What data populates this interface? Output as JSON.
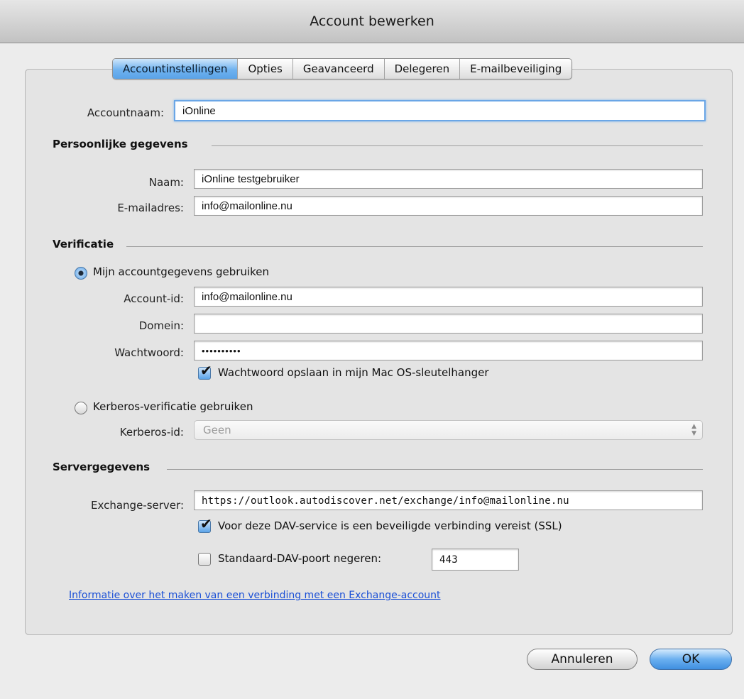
{
  "window": {
    "title": "Account bewerken"
  },
  "tabs": [
    {
      "label": "Accountinstellingen",
      "active": true
    },
    {
      "label": "Opties"
    },
    {
      "label": "Geavanceerd"
    },
    {
      "label": "Delegeren"
    },
    {
      "label": "E-mailbeveiliging"
    }
  ],
  "account": {
    "label": "Accountnaam:",
    "value": "iOnline"
  },
  "personal": {
    "heading": "Persoonlijke gegevens",
    "name_label": "Naam:",
    "name_value": "iOnline testgebruiker",
    "email_label": "E-mailadres:",
    "email_value": "info@mailonline.nu"
  },
  "verification": {
    "heading": "Verificatie",
    "use_account_label": "Mijn accountgegevens gebruiken",
    "account_id_label": "Account-id:",
    "account_id_value": "info@mailonline.nu",
    "domain_label": "Domein:",
    "domain_value": "",
    "password_label": "Wachtwoord:",
    "password_value": "••••••••••",
    "keychain_label": "Wachtwoord opslaan in mijn Mac OS-sleutelhanger",
    "keychain_checked": true,
    "kerberos_label": "Kerberos-verificatie gebruiken",
    "kerberos_id_label": "Kerberos-id:",
    "kerberos_id_value": "Geen"
  },
  "server": {
    "heading": "Servergegevens",
    "exchange_label": "Exchange-server:",
    "exchange_value": "https://outlook.autodiscover.net/exchange/info@mailonline.nu",
    "ssl_label": "Voor deze DAV-service is een beveiligde verbinding vereist (SSL)",
    "ssl_checked": true,
    "port_label": "Standaard-DAV-poort negeren:",
    "port_checked": false,
    "port_value": "443"
  },
  "help_link": "Informatie over het maken van een verbinding met een Exchange-account",
  "buttons": {
    "cancel": "Annuleren",
    "ok": "OK"
  },
  "colors": {
    "accent": "#5aa3e8",
    "link": "#1a4fd6",
    "window_bg": "#ececec"
  }
}
